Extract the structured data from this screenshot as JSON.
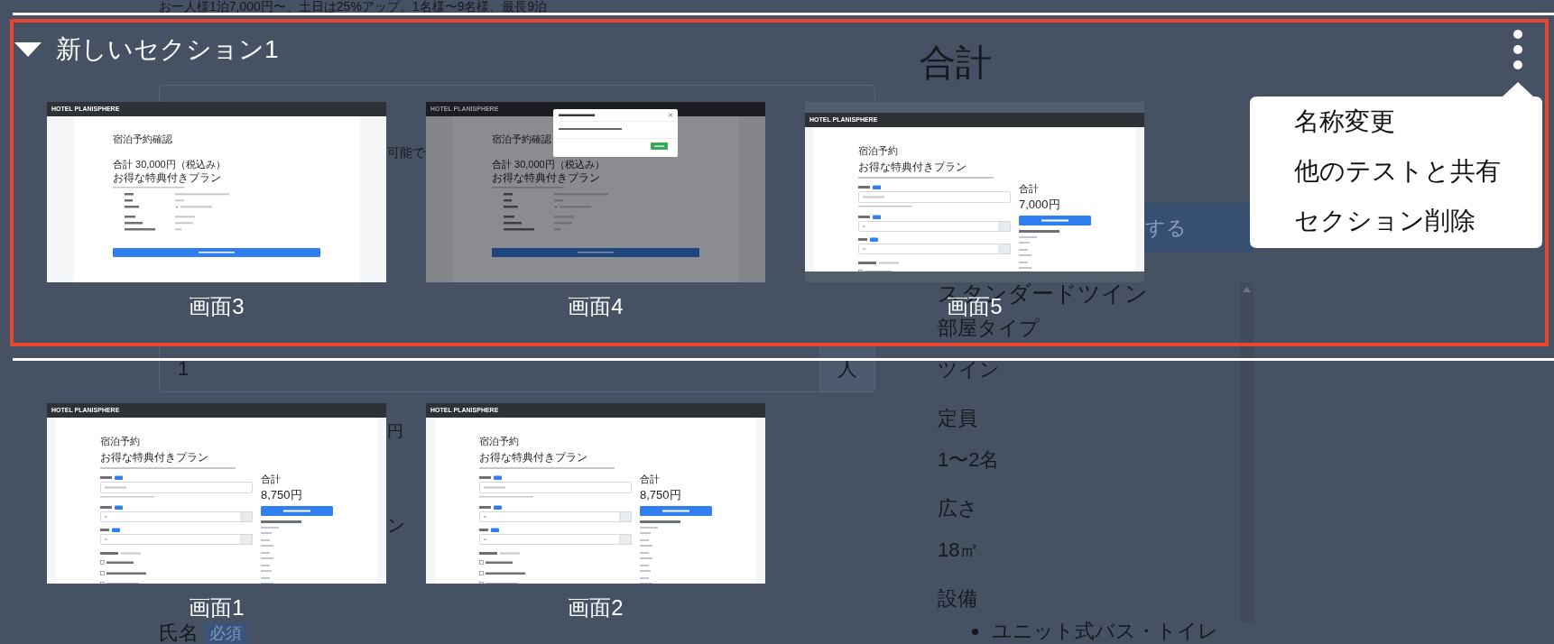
{
  "background_page": {
    "description": "お一人様1泊7,000円〜、土日は25%アップ。1名様〜9名様、最長9泊",
    "form_items": [
      {
        "kind": "field"
      },
      {
        "kind": "hint",
        "text": "可能で"
      },
      {
        "kind": "field",
        "value": "1",
        "unit": "人"
      },
      {
        "kind": "hint",
        "text": "円"
      },
      {
        "kind": "option",
        "text": "ン"
      },
      {
        "kind": "label",
        "text": "氏名",
        "badge": "必須"
      }
    ],
    "total_heading": "合計",
    "confirm_button": "する",
    "room": {
      "name": "スタンダードツイン",
      "details": [
        {
          "label": "部屋タイプ",
          "value": "ツイン"
        },
        {
          "label": "定員",
          "value": "1〜2名"
        },
        {
          "label": "広さ",
          "value": "18㎡"
        }
      ],
      "amenities_label": "設備",
      "amenities": [
        "ユニット式バス・トイレ"
      ]
    }
  },
  "section": {
    "title": "新しいセクション1",
    "expanded": true,
    "selected": true,
    "menu": {
      "items": [
        "名称変更",
        "他のテストと共有",
        "セクション削除"
      ]
    },
    "screens": [
      {
        "label": "画面3",
        "kind": "confirm",
        "modal": false,
        "letterboxed": false,
        "header": "HOTEL PLANISPHERE",
        "title": "宿泊予約確認",
        "total": "合計 30,000円（税込み）",
        "plan": "お得な特典付きプラン"
      },
      {
        "label": "画面4",
        "kind": "confirm",
        "modal": true,
        "letterboxed": false,
        "header": "HOTEL PLANISPHERE",
        "title": "宿泊予約確認",
        "total": "合計 30,000円（税込み）",
        "plan": "お得な特典付きプラン"
      },
      {
        "label": "画面5",
        "kind": "form",
        "modal": false,
        "letterboxed": true,
        "header": "HOTEL PLANISPHERE",
        "title": "宿泊予約",
        "plan": "お得な特典付きプラン",
        "total_label": "合計",
        "total": "7,000円"
      }
    ]
  },
  "other_screens": [
    {
      "label": "画面1",
      "kind": "form",
      "modal": false,
      "letterboxed": false,
      "header": "HOTEL PLANISPHERE",
      "title": "宿泊予約",
      "plan": "お得な特典付きプラン",
      "total_label": "合計",
      "total": "8,750円"
    },
    {
      "label": "画面2",
      "kind": "form",
      "modal": false,
      "letterboxed": false,
      "header": "HOTEL PLANISPHERE",
      "title": "宿泊予約",
      "plan": "お得な特典付きプラン",
      "total_label": "合計",
      "total": "8,750円"
    }
  ]
}
